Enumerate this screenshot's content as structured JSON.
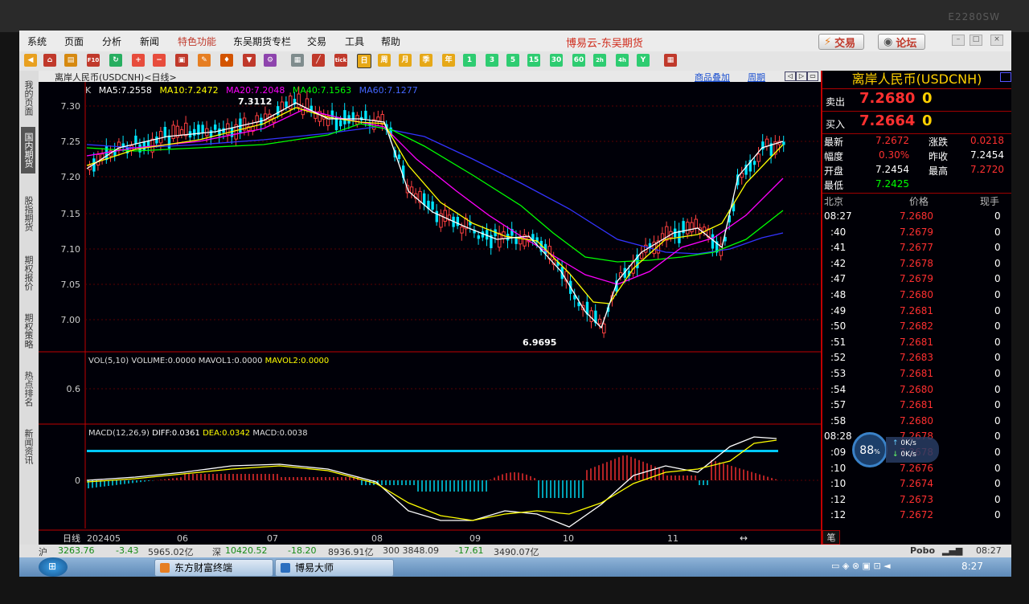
{
  "bezel": {
    "model": "E2280SW"
  },
  "app": {
    "title": "博易云-东吴期货"
  },
  "menu": [
    "系统",
    "页面",
    "分析",
    "新闻",
    "特色功能",
    "东吴期货专栏",
    "交易",
    "工具",
    "帮助"
  ],
  "buttons": {
    "trade": "交易",
    "forum": "论坛"
  },
  "chart": {
    "symbol_label": "离岸人民币(USDCNH)<日线>",
    "overlay_link": "商品叠加",
    "period_link": "周期",
    "k_label": "K",
    "ma5": "MA5:7.2558",
    "ma10": "MA10:7.2472",
    "ma20": "MA20:7.2048",
    "ma40": "MA40:7.1563",
    "ma60": "MA60:7.1277",
    "high_mark": "7.3112",
    "low_mark": "6.9695",
    "vol_label": "VOL(5,10) VOLUME:0.0000 MAVOL1:0.0000",
    "mavol2": "MAVOL2:0.0000",
    "macd_label": "MACD(12,26,9)",
    "diff": "DIFF:0.0361",
    "dea": "DEA:0.0342",
    "macd": "MACD:0.0038",
    "period_name": "日线",
    "vol_tick": "0.6",
    "macd_tick": "0"
  },
  "chart_data": {
    "type": "candlestick",
    "y_ticks": [
      7.3,
      7.25,
      7.2,
      7.15,
      7.1,
      7.05,
      7.0
    ],
    "ylim": [
      6.96,
      7.33
    ],
    "x_labels": [
      "202405",
      "06",
      "07",
      "08",
      "09",
      "10",
      "11"
    ],
    "series": [
      {
        "name": "MA5",
        "color": "#ffffff"
      },
      {
        "name": "MA10",
        "color": "#ffff00"
      },
      {
        "name": "MA20",
        "color": "#ff00ff"
      },
      {
        "name": "MA40",
        "color": "#00ff00"
      },
      {
        "name": "MA60",
        "color": "#3333ff"
      }
    ],
    "high": 7.3112,
    "low": 6.9695
  },
  "quote": {
    "name": "离岸人民币(USDCNH)",
    "ask_label": "卖出",
    "ask": "7.2680",
    "ask_vol": "0",
    "bid_label": "买入",
    "bid": "7.2664",
    "bid_vol": "0",
    "last_label": "最新",
    "last": "7.2672",
    "chg_label": "涨跌",
    "chg": "0.0218",
    "pct_label": "幅度",
    "pct": "0.30%",
    "prev_label": "昨收",
    "prev": "7.2454",
    "open_label": "开盘",
    "open": "7.2454",
    "high_label": "最高",
    "high": "7.2720",
    "low_label": "最低",
    "low": "7.2425"
  },
  "ticks_header": {
    "time": "北京",
    "price": "价格",
    "vol": "现手"
  },
  "ticks": [
    {
      "t": "08:27",
      "p": "7.2680",
      "v": "0"
    },
    {
      "t": ":40",
      "p": "7.2679",
      "v": "0"
    },
    {
      "t": ":41",
      "p": "7.2677",
      "v": "0"
    },
    {
      "t": ":42",
      "p": "7.2678",
      "v": "0"
    },
    {
      "t": ":47",
      "p": "7.2679",
      "v": "0"
    },
    {
      "t": ":48",
      "p": "7.2680",
      "v": "0"
    },
    {
      "t": ":49",
      "p": "7.2681",
      "v": "0"
    },
    {
      "t": ":50",
      "p": "7.2682",
      "v": "0"
    },
    {
      "t": ":51",
      "p": "7.2681",
      "v": "0"
    },
    {
      "t": ":52",
      "p": "7.2683",
      "v": "0"
    },
    {
      "t": ":53",
      "p": "7.2681",
      "v": "0"
    },
    {
      "t": ":54",
      "p": "7.2680",
      "v": "0"
    },
    {
      "t": ":57",
      "p": "7.2681",
      "v": "0"
    },
    {
      "t": ":58",
      "p": "7.2680",
      "v": "0"
    },
    {
      "t": "08:28",
      "p": "7.2678",
      "v": "0"
    },
    {
      "t": ":09",
      "p": "7.2678",
      "v": "0"
    },
    {
      "t": ":10",
      "p": "7.2676",
      "v": "0"
    },
    {
      "t": ":10",
      "p": "7.2674",
      "v": "0"
    },
    {
      "t": ":12",
      "p": "7.2673",
      "v": "0"
    },
    {
      "t": ":12",
      "p": "7.2672",
      "v": "0"
    }
  ],
  "widget": {
    "pct": "88",
    "pct_sign": "%",
    "up": "0K/s",
    "down": "0K/s"
  },
  "side_tabs": [
    "我的页面",
    "国内期货",
    "股指期货",
    "期权报价",
    "期权策略",
    "热点排名",
    "新闻资讯"
  ],
  "status": {
    "sh_label": "沪",
    "sh_val": "3263.76",
    "sh_chg": "-3.43",
    "sh_amt": "5965.02亿",
    "sz_label": "深",
    "sz_val": "10420.52",
    "sz_chg": "-18.20",
    "sz_amt": "8936.91亿",
    "cy_val": "300 3848.09",
    "cy_chg": "-17.61",
    "cy_amt": "3490.07亿",
    "brand": "Pobo",
    "time": "08:27"
  },
  "taskbar": {
    "task1": "东方财富终端",
    "task2": "博易大师",
    "clock": "8:27"
  },
  "right_bottom_label": "笔"
}
